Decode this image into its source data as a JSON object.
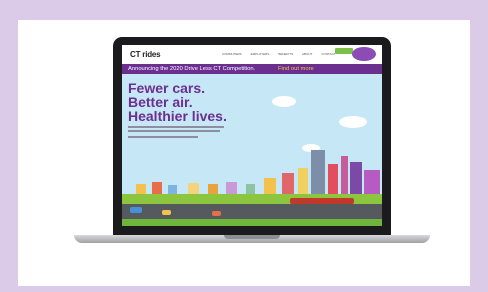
{
  "site": {
    "logo": "CT rides",
    "nav": [
      "COMMUTERS",
      "EMPLOYERS",
      "BENEFITS",
      "ABOUT",
      "CONTACT"
    ],
    "banner": {
      "text": "Announcing the 2020 Drive Less CT Competition.",
      "link": "Find out more"
    },
    "hero": {
      "headline_1": "Fewer cars.",
      "headline_2": "Better air.",
      "headline_3": "Healthier lives."
    }
  },
  "colors": {
    "background": "#dccbe8",
    "purple": "#6b2f8f",
    "green": "#7cc04a",
    "sky": "#c6e7f5"
  }
}
